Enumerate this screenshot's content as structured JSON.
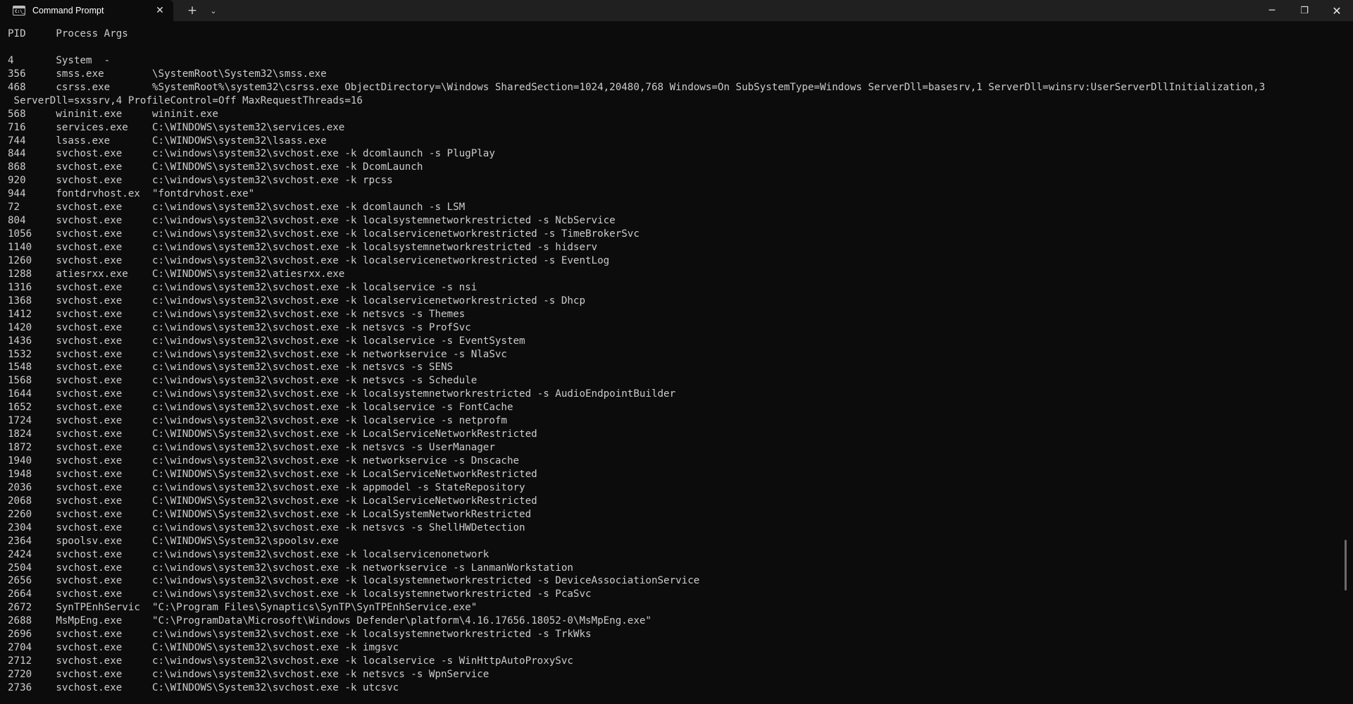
{
  "tab": {
    "title": "Command Prompt",
    "icon_name": "cmd-icon",
    "icon_text": "C:\\_",
    "close_glyph": "✕"
  },
  "toolbar": {
    "new_tab_glyph": "+",
    "dropdown_glyph": "⌄"
  },
  "window_controls": {
    "minimize": "─",
    "maximize": "❐",
    "close": "✕"
  },
  "colors": {
    "background": "#0c0c0c",
    "titlebar": "#202020",
    "foreground": "#cccccc"
  },
  "terminal": {
    "lines": [
      "PID     Process Args",
      "",
      "4       System  -",
      "356     smss.exe        \\SystemRoot\\System32\\smss.exe",
      "468     csrss.exe       %SystemRoot%\\system32\\csrss.exe ObjectDirectory=\\Windows SharedSection=1024,20480,768 Windows=On SubSystemType=Windows ServerDll=basesrv,1 ServerDll=winsrv:UserServerDllInitialization,3",
      " ServerDll=sxssrv,4 ProfileControl=Off MaxRequestThreads=16",
      "568     wininit.exe     wininit.exe",
      "716     services.exe    C:\\WINDOWS\\system32\\services.exe",
      "744     lsass.exe       C:\\WINDOWS\\system32\\lsass.exe",
      "844     svchost.exe     c:\\windows\\system32\\svchost.exe -k dcomlaunch -s PlugPlay",
      "868     svchost.exe     C:\\WINDOWS\\system32\\svchost.exe -k DcomLaunch",
      "920     svchost.exe     c:\\windows\\system32\\svchost.exe -k rpcss",
      "944     fontdrvhost.ex  \"fontdrvhost.exe\"",
      "72      svchost.exe     c:\\windows\\system32\\svchost.exe -k dcomlaunch -s LSM",
      "804     svchost.exe     c:\\windows\\system32\\svchost.exe -k localsystemnetworkrestricted -s NcbService",
      "1056    svchost.exe     c:\\windows\\system32\\svchost.exe -k localservicenetworkrestricted -s TimeBrokerSvc",
      "1140    svchost.exe     c:\\windows\\system32\\svchost.exe -k localsystemnetworkrestricted -s hidserv",
      "1260    svchost.exe     c:\\windows\\system32\\svchost.exe -k localservicenetworkrestricted -s EventLog",
      "1288    atiesrxx.exe    C:\\WINDOWS\\system32\\atiesrxx.exe",
      "1316    svchost.exe     c:\\windows\\system32\\svchost.exe -k localservice -s nsi",
      "1368    svchost.exe     c:\\windows\\system32\\svchost.exe -k localservicenetworkrestricted -s Dhcp",
      "1412    svchost.exe     c:\\windows\\system32\\svchost.exe -k netsvcs -s Themes",
      "1420    svchost.exe     c:\\windows\\system32\\svchost.exe -k netsvcs -s ProfSvc",
      "1436    svchost.exe     c:\\windows\\system32\\svchost.exe -k localservice -s EventSystem",
      "1532    svchost.exe     c:\\windows\\system32\\svchost.exe -k networkservice -s NlaSvc",
      "1548    svchost.exe     c:\\windows\\system32\\svchost.exe -k netsvcs -s SENS",
      "1568    svchost.exe     c:\\windows\\system32\\svchost.exe -k netsvcs -s Schedule",
      "1644    svchost.exe     c:\\windows\\system32\\svchost.exe -k localsystemnetworkrestricted -s AudioEndpointBuilder",
      "1652    svchost.exe     c:\\windows\\system32\\svchost.exe -k localservice -s FontCache",
      "1724    svchost.exe     c:\\windows\\system32\\svchost.exe -k localservice -s netprofm",
      "1824    svchost.exe     C:\\WINDOWS\\System32\\svchost.exe -k LocalServiceNetworkRestricted",
      "1872    svchost.exe     c:\\windows\\system32\\svchost.exe -k netsvcs -s UserManager",
      "1940    svchost.exe     c:\\windows\\system32\\svchost.exe -k networkservice -s Dnscache",
      "1948    svchost.exe     C:\\WINDOWS\\System32\\svchost.exe -k LocalServiceNetworkRestricted",
      "2036    svchost.exe     c:\\windows\\system32\\svchost.exe -k appmodel -s StateRepository",
      "2068    svchost.exe     C:\\WINDOWS\\System32\\svchost.exe -k LocalServiceNetworkRestricted",
      "2260    svchost.exe     C:\\WINDOWS\\System32\\svchost.exe -k LocalSystemNetworkRestricted",
      "2304    svchost.exe     c:\\windows\\system32\\svchost.exe -k netsvcs -s ShellHWDetection",
      "2364    spoolsv.exe     C:\\WINDOWS\\System32\\spoolsv.exe",
      "2424    svchost.exe     c:\\windows\\system32\\svchost.exe -k localservicenonetwork",
      "2504    svchost.exe     c:\\windows\\system32\\svchost.exe -k networkservice -s LanmanWorkstation",
      "2656    svchost.exe     c:\\windows\\system32\\svchost.exe -k localsystemnetworkrestricted -s DeviceAssociationService",
      "2664    svchost.exe     c:\\windows\\system32\\svchost.exe -k localsystemnetworkrestricted -s PcaSvc",
      "2672    SynTPEnhServic  \"C:\\Program Files\\Synaptics\\SynTP\\SynTPEnhService.exe\"",
      "2688    MsMpEng.exe     \"C:\\ProgramData\\Microsoft\\Windows Defender\\platform\\4.16.17656.18052-0\\MsMpEng.exe\"",
      "2696    svchost.exe     c:\\windows\\system32\\svchost.exe -k localsystemnetworkrestricted -s TrkWks",
      "2704    svchost.exe     C:\\WINDOWS\\system32\\svchost.exe -k imgsvc",
      "2712    svchost.exe     c:\\windows\\system32\\svchost.exe -k localservice -s WinHttpAutoProxySvc",
      "2720    svchost.exe     c:\\windows\\system32\\svchost.exe -k netsvcs -s WpnService",
      "2736    svchost.exe     C:\\WINDOWS\\System32\\svchost.exe -k utcsvc"
    ]
  }
}
